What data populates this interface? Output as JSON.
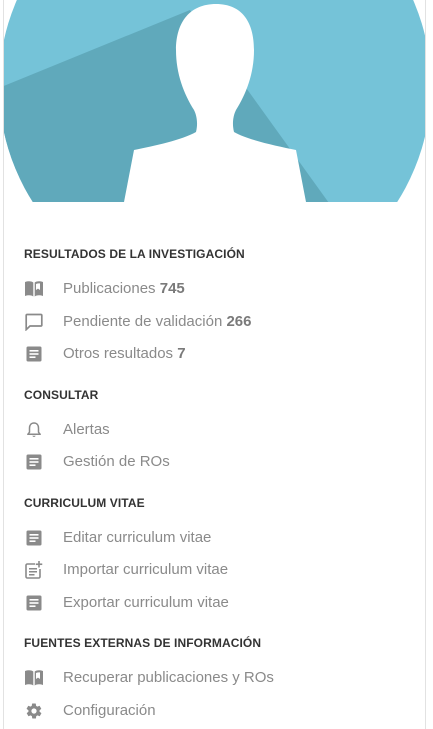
{
  "sections": [
    {
      "title": "RESULTADOS DE LA INVESTIGACIÓN",
      "items": [
        {
          "label": "Publicaciones",
          "count": "745",
          "icon": "book-icon"
        },
        {
          "label": "Pendiente de validación",
          "count": "266",
          "icon": "comment-icon"
        },
        {
          "label": "Otros resultados",
          "count": "7",
          "icon": "document-icon"
        }
      ]
    },
    {
      "title": "CONSULTAR",
      "items": [
        {
          "label": "Alertas",
          "icon": "bell-icon"
        },
        {
          "label": "Gestión de ROs",
          "icon": "document-icon"
        }
      ]
    },
    {
      "title": "CURRICULUM VITAE",
      "items": [
        {
          "label": "Editar curriculum vitae",
          "icon": "document-icon"
        },
        {
          "label": "Importar curriculum vitae",
          "icon": "document-add-icon"
        },
        {
          "label": "Exportar curriculum vitae",
          "icon": "document-icon"
        }
      ]
    },
    {
      "title": "FUENTES EXTERNAS DE INFORMACIÓN",
      "items": [
        {
          "label": "Recuperar publicaciones y ROs",
          "icon": "book-icon"
        },
        {
          "label": "Configuración",
          "icon": "gear-icon"
        }
      ]
    }
  ],
  "colors": {
    "avatar_light": "#75c3d8",
    "avatar_dark": "#60a9bb",
    "icon": "#8a8a8a",
    "heading": "#333333",
    "text": "#8a8a8a"
  }
}
